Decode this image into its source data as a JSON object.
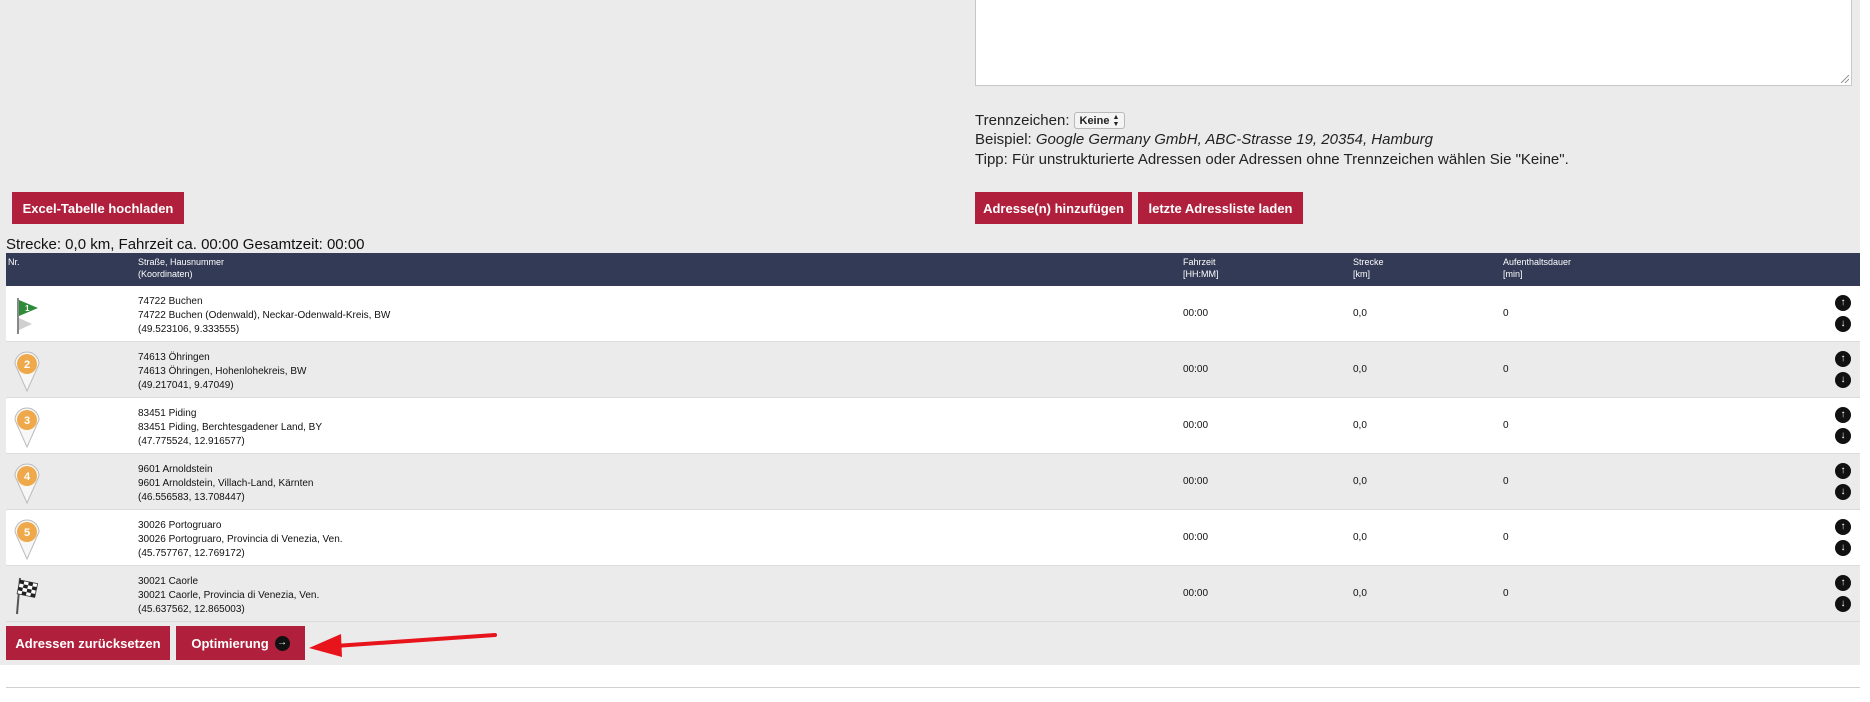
{
  "separator": {
    "label": "Trennzeichen:",
    "selected": "Keine",
    "example_label": "Beispiel:",
    "example_value": "Google Germany GmbH, ABC-Strasse 19, 20354, Hamburg",
    "tip": "Tipp: Für unstrukturierte Adressen oder Adressen ohne Trennzeichen wählen Sie \"Keine\"."
  },
  "buttons": {
    "excel_upload": "Excel-Tabelle hochladen",
    "add_addresses": "Adresse(n) hinzufügen",
    "load_last_list": "letzte Adressliste laden",
    "reset_addresses": "Adressen zurücksetzen",
    "optimize": "Optimierung"
  },
  "summary": "Strecke: 0,0 km, Fahrzeit ca. 00:00 Gesamtzeit: 00:00",
  "table": {
    "headers": {
      "nr": "Nr.",
      "street": "Straße, Hausnummer",
      "street_sub": "(Koordinaten)",
      "drive_time": "Fahrzeit",
      "drive_time_unit": "[HH:MM]",
      "distance": "Strecke",
      "distance_unit": "[km]",
      "stay": "Aufenthaltsdauer",
      "stay_unit": "[min]"
    },
    "rows": [
      {
        "marker": "start-flag-icon",
        "line1": "74722 Buchen",
        "line2": "74722 Buchen (Odenwald), Neckar-Odenwald-Kreis, BW",
        "coords": "(49.523106, 9.333555)",
        "time": "00:00",
        "distance": "0,0",
        "stay": "0"
      },
      {
        "marker": "2",
        "line1": "74613 Öhringen",
        "line2": "74613 Öhringen, Hohenlohekreis, BW",
        "coords": "(49.217041, 9.47049)",
        "time": "00:00",
        "distance": "0,0",
        "stay": "0"
      },
      {
        "marker": "3",
        "line1": "83451 Piding",
        "line2": "83451 Piding, Berchtesgadener Land, BY",
        "coords": "(47.775524, 12.916577)",
        "time": "00:00",
        "distance": "0,0",
        "stay": "0"
      },
      {
        "marker": "4",
        "line1": "9601 Arnoldstein",
        "line2": "9601 Arnoldstein, Villach-Land, Kärnten",
        "coords": "(46.556583, 13.708447)",
        "time": "00:00",
        "distance": "0,0",
        "stay": "0"
      },
      {
        "marker": "5",
        "line1": "30026 Portogruaro",
        "line2": "30026 Portogruaro, Provincia di Venezia, Ven.",
        "coords": "(45.757767, 12.769172)",
        "time": "00:00",
        "distance": "0,0",
        "stay": "0"
      },
      {
        "marker": "finish-flag-icon",
        "line1": "30021 Caorle",
        "line2": "30021 Caorle, Provincia di Venezia, Ven.",
        "coords": "(45.637562, 12.865003)",
        "time": "00:00",
        "distance": "0,0",
        "stay": "0"
      }
    ]
  },
  "colors": {
    "button_red": "#b01f3c",
    "header_navy": "#333a55",
    "marker_orange": "#f0a94a",
    "annotation_arrow": "#e8141c"
  }
}
